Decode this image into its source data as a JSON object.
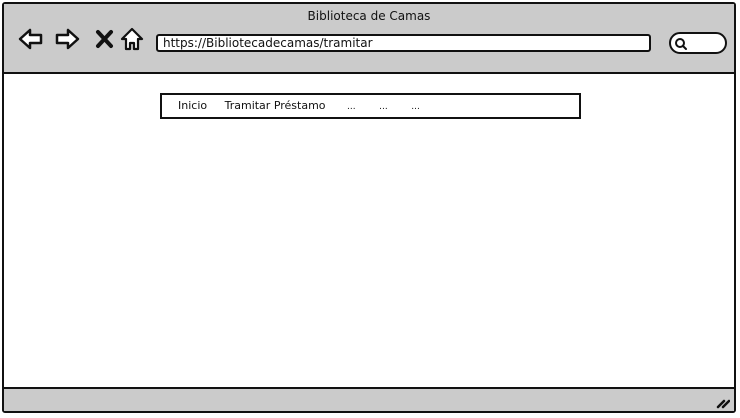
{
  "window": {
    "title": "Biblioteca de Camas"
  },
  "toolbar": {
    "back_icon": "back-arrow-icon",
    "forward_icon": "forward-arrow-icon",
    "close_icon": "close-x-icon",
    "home_icon": "home-icon",
    "url": "https://Bibliotecadecamas/tramitar",
    "search_icon": "search-icon"
  },
  "breadcrumb": {
    "items": [
      "Inicio",
      "Tramitar Préstamo",
      "...",
      "...",
      "..."
    ]
  },
  "colors": {
    "chrome": "#cbcbcb",
    "stroke": "#111111",
    "background": "#ffffff"
  }
}
